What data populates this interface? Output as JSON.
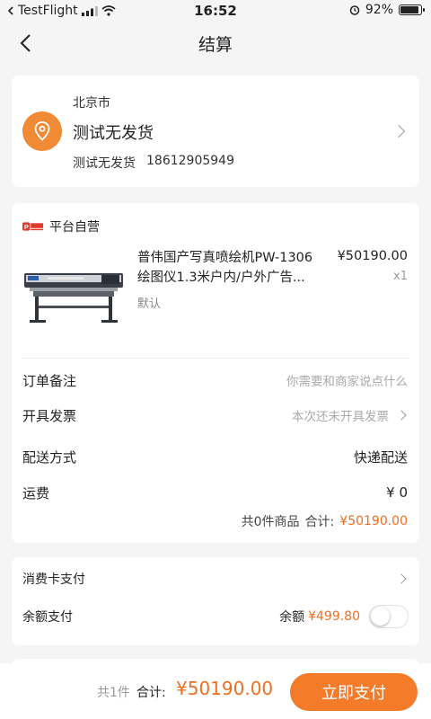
{
  "status_bar": {
    "carrier": "TestFlight",
    "time": "16:52",
    "battery": "92%",
    "battery_level": 0.92
  },
  "nav": {
    "title": "结算"
  },
  "address": {
    "city": "北京市",
    "detail": "测试无发货",
    "name": "测试无发货",
    "phone": "18612905949"
  },
  "order": {
    "shop_name": "平台自营",
    "shop_logo_text": "普伟",
    "product": {
      "name_line1": "普伟国产写真喷绘机PW-1306",
      "name_line2": "绘图仪1.3米户内/户外广告...",
      "spec": "默认",
      "price": "¥50190.00",
      "quantity": "x1"
    },
    "remark_label": "订单备注",
    "remark_placeholder": "你需要和商家说点什么",
    "invoice_label": "开具发票",
    "invoice_value": "本次还未开具发票",
    "delivery_label": "配送方式",
    "delivery_value": "快递配送",
    "freight_label": "运费",
    "freight_value": "¥ 0",
    "summary_count": "共0件商品",
    "summary_total_label": "合计:",
    "summary_total": "¥50190.00"
  },
  "payment": {
    "card_label": "消费卡支付",
    "balance_label": "余额支付",
    "balance_prefix": "余额",
    "balance_amount": "¥499.80",
    "balance_enabled": false
  },
  "bottom_bar": {
    "count": "共1件",
    "total_label": "合计:",
    "total": "¥50190.00",
    "pay_button": "立即支付"
  },
  "colors": {
    "accent": "#f37b29",
    "price": "#ee6e22"
  }
}
